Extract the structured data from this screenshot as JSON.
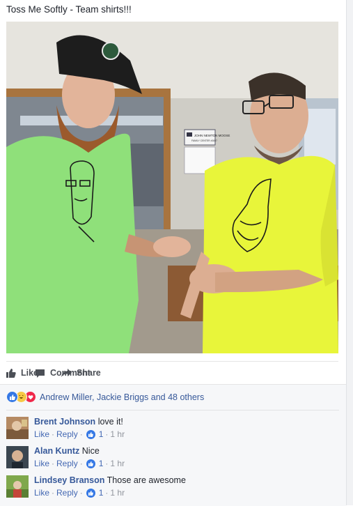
{
  "post": {
    "text": "Toss Me Softly - Team shirts!!!"
  },
  "photo": {
    "sign_title": "JOHN NEWTON MOOSE",
    "sign_subtitle": "FAMILY CENTER #1607"
  },
  "actions": {
    "like_label": "Like",
    "comment_label": "Comment",
    "share_label": "Share"
  },
  "reactions": {
    "icons": [
      "like",
      "haha",
      "love"
    ],
    "summary": "Andrew Miller, Jackie Briggs and 48 others"
  },
  "comments": [
    {
      "author": "Brent Johnson",
      "text": "love it!",
      "like": "Like",
      "reply": "Reply",
      "likes": "1",
      "time": "1 hr"
    },
    {
      "author": "Alan Kuntz",
      "text": "Nice",
      "like": "Like",
      "reply": "Reply",
      "likes": "1",
      "time": "1 hr"
    },
    {
      "author": "Lindsey Branson",
      "text": "Those are awesome",
      "like": "Like",
      "reply": "Reply",
      "likes": "1",
      "time": "1 hr"
    }
  ],
  "colors": {
    "link_blue": "#365899",
    "like_blue": "#3578e5",
    "green_shirt": "#8fe07a",
    "yellow_shirt": "#e8f53a"
  }
}
